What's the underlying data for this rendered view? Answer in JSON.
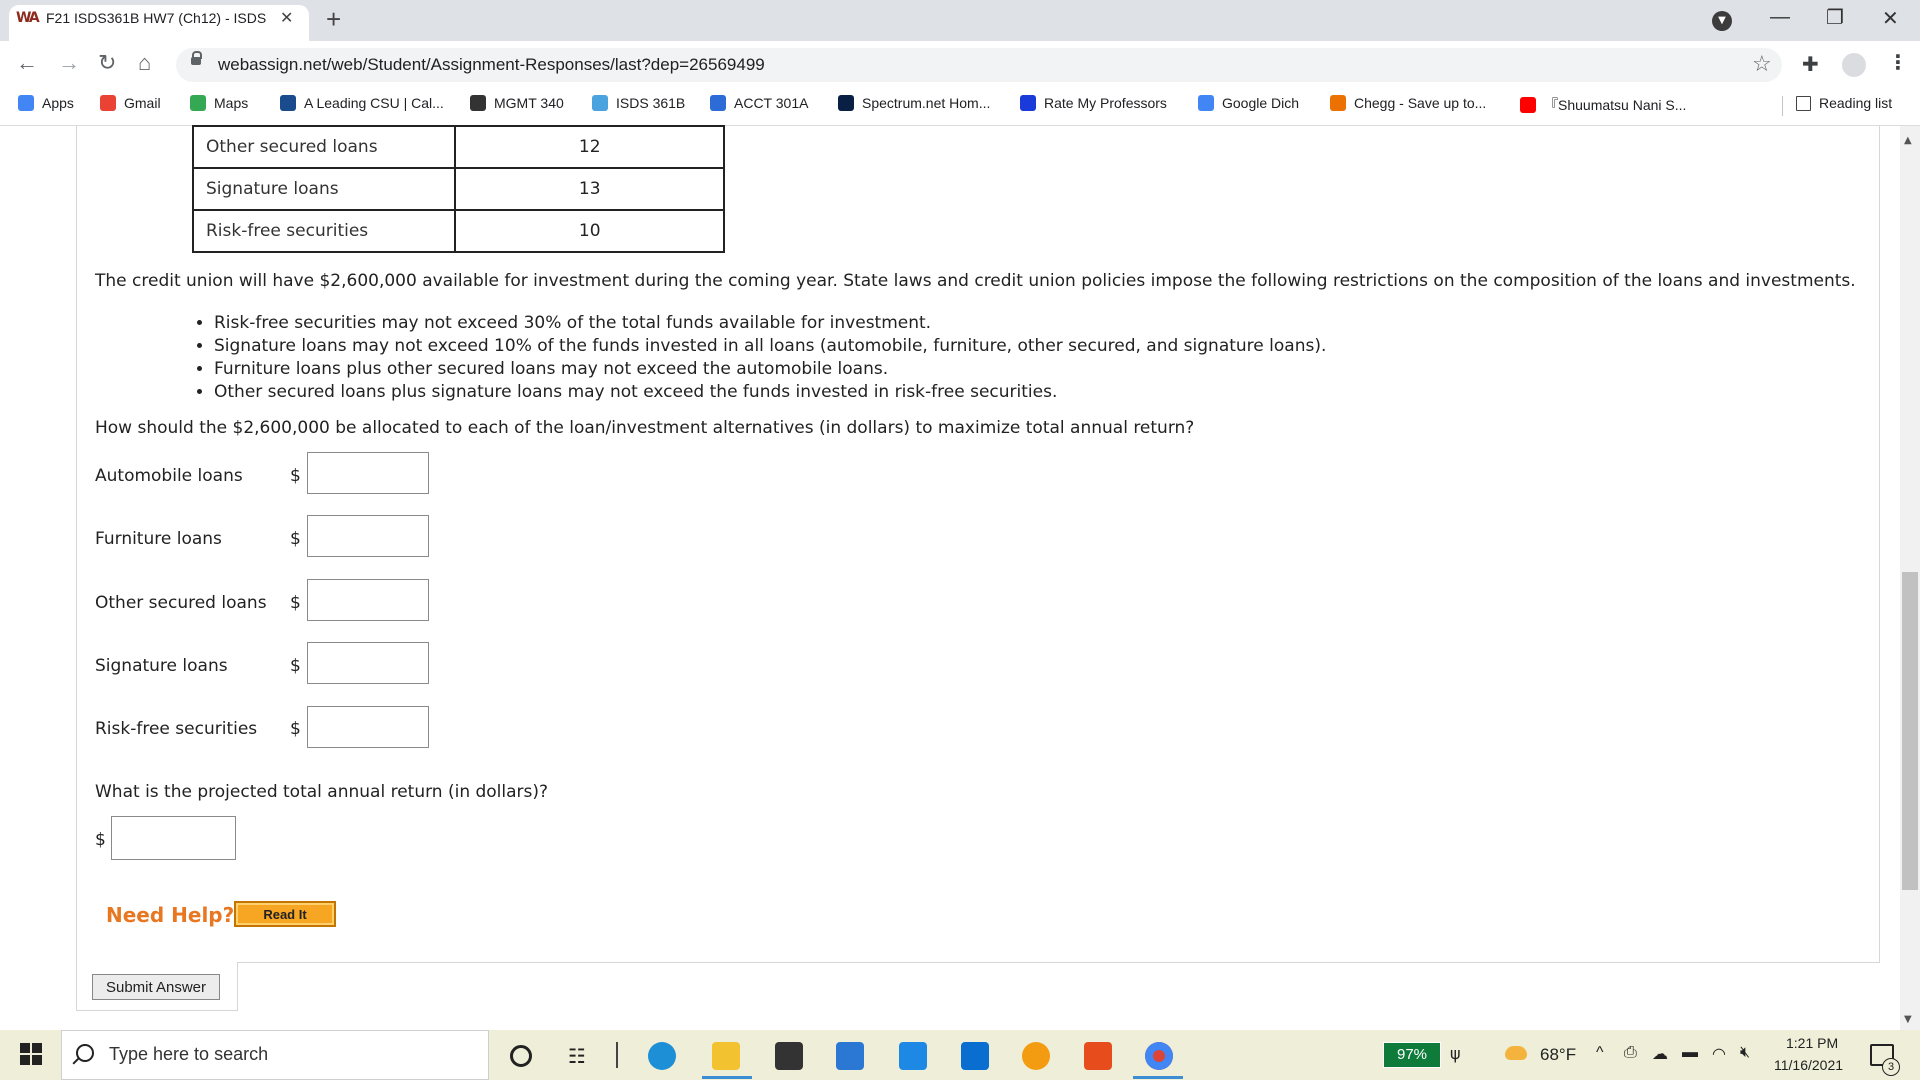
{
  "browser": {
    "tab_title": "F21 ISDS361B HW7 (Ch12) - ISDS",
    "tab_favicon": "WA",
    "new_tab": "+",
    "url": "webassign.net/web/Student/Assignment-Responses/last?dep=26569499",
    "reading_list": "Reading list",
    "bookmarks": [
      {
        "label": "Apps",
        "icon": "apps-grid-icon",
        "color": "#4285f4"
      },
      {
        "label": "Gmail",
        "icon": "gmail-icon",
        "color": "#ea4335"
      },
      {
        "label": "Maps",
        "icon": "maps-icon",
        "color": "#34a853"
      },
      {
        "label": "A Leading CSU | Cal...",
        "icon": "csu-icon",
        "color": "#1a4b8c"
      },
      {
        "label": "MGMT 340",
        "icon": "mgmt-icon",
        "color": "#333333"
      },
      {
        "label": "ISDS 361B",
        "icon": "isds-icon",
        "color": "#4aa3df"
      },
      {
        "label": "ACCT 301A",
        "icon": "wp-icon",
        "color": "#2d6bd6"
      },
      {
        "label": "Spectrum.net Hom...",
        "icon": "spectrum-icon",
        "color": "#0a1f44"
      },
      {
        "label": "Rate My Professors",
        "icon": "rmp-icon",
        "color": "#1a3bd9"
      },
      {
        "label": "Google Dich",
        "icon": "google-translate-icon",
        "color": "#4285f4"
      },
      {
        "label": "Chegg - Save up to...",
        "icon": "chegg-icon",
        "color": "#eb7100"
      },
      {
        "label": "『Shuumatsu Nani S...",
        "icon": "youtube-icon",
        "color": "#ff0000"
      }
    ]
  },
  "table": {
    "rows": [
      {
        "label": "Other secured loans",
        "value": "12"
      },
      {
        "label": "Signature loans",
        "value": "13"
      },
      {
        "label": "Risk-free securities",
        "value": "10"
      }
    ]
  },
  "problem": {
    "intro": "The credit union will have $2,600,000 available for investment during the coming year. State laws and credit union policies impose the following restrictions on the composition of the loans and investments.",
    "restrictions": [
      "Risk-free securities may not exceed 30% of the total funds available for investment.",
      "Signature loans may not exceed 10% of the funds invested in all loans (automobile, furniture, other secured, and signature loans).",
      "Furniture loans plus other secured loans may not exceed the automobile loans.",
      "Other secured loans plus signature loans may not exceed the funds invested in risk-free securities."
    ],
    "question1": "How should the $2,600,000 be allocated to each of the loan/investment alternatives (in dollars) to maximize total annual return?",
    "answers": [
      {
        "label": "Automobile loans",
        "currency": "$",
        "value": ""
      },
      {
        "label": "Furniture loans",
        "currency": "$",
        "value": ""
      },
      {
        "label": "Other secured loans",
        "currency": "$",
        "value": ""
      },
      {
        "label": "Signature loans",
        "currency": "$",
        "value": ""
      },
      {
        "label": "Risk-free securities",
        "currency": "$",
        "value": ""
      }
    ],
    "question2": "What is the projected total annual return (in dollars)?",
    "total_currency": "$",
    "total_value": "",
    "need_help": "Need Help?",
    "read_it": "Read It",
    "submit": "Submit Answer"
  },
  "taskbar": {
    "search_placeholder": "Type here to search",
    "battery": "97%",
    "temperature": "68°F",
    "time": "1:21 PM",
    "date": "11/16/2021",
    "notifications": "3"
  },
  "colors": {
    "need_help": "#e87722",
    "read_it_bg": "#f6a623",
    "battery_badge": "#0f7b3a",
    "taskbar_bg": "#efefd9"
  }
}
